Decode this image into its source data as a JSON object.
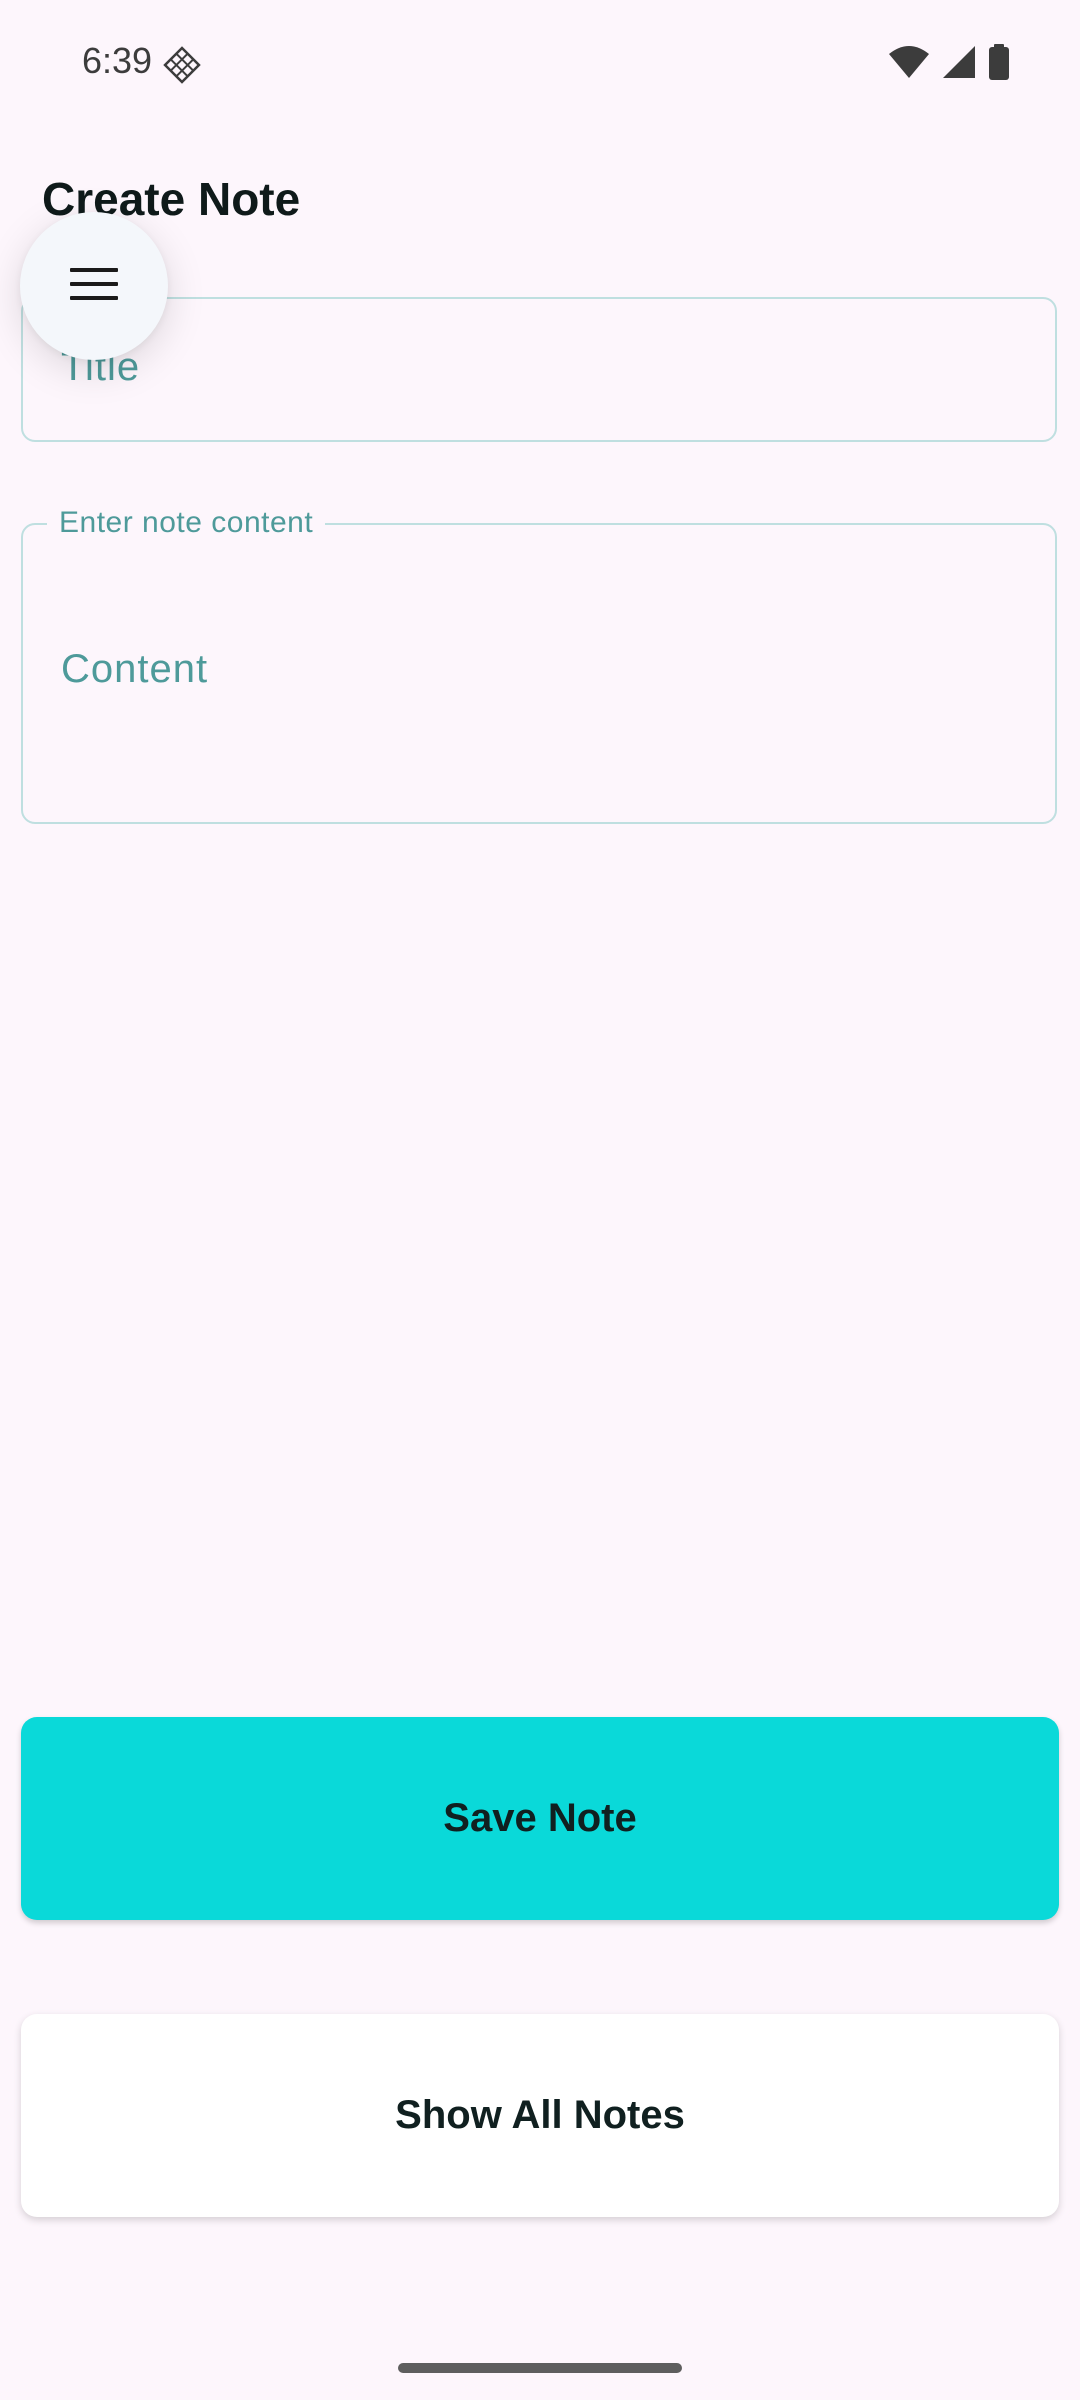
{
  "status_bar": {
    "time": "6:39",
    "icons": [
      "notification-diamond-icon",
      "wifi-icon",
      "cellular-signal-icon",
      "battery-icon"
    ]
  },
  "header": {
    "title": "Create Note",
    "menu_icon": "hamburger-menu-icon"
  },
  "form": {
    "title_field": {
      "placeholder": "Title",
      "value": ""
    },
    "content_field": {
      "label": "Enter note content",
      "placeholder": "Content",
      "value": ""
    }
  },
  "actions": {
    "save_label": "Save Note",
    "show_all_label": "Show All Notes"
  },
  "colors": {
    "background": "#fdf6fc",
    "accent": "#0ad9d9",
    "field_border": "#bfdfe0",
    "placeholder_text": "#4e9a9a"
  }
}
